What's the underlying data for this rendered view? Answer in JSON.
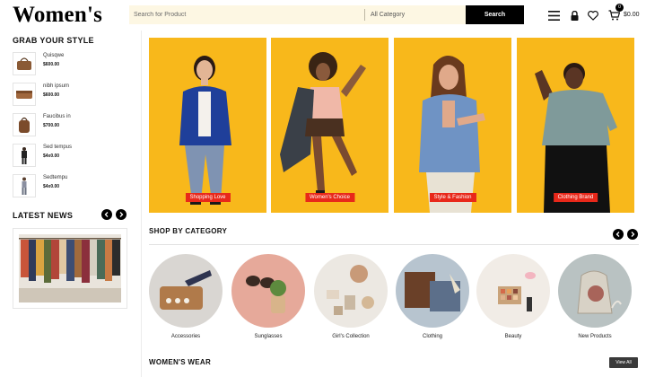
{
  "header": {
    "logo": "Women's",
    "search_placeholder": "Search for Product",
    "category_value": "All Category",
    "search_button": "Search",
    "cart_count": "0",
    "cart_total": "$0.00"
  },
  "sidebar": {
    "grab_title": "GRAB YOUR STYLE",
    "products": [
      {
        "name": "Quisqwe",
        "price": "$600.00"
      },
      {
        "name": "nibh ipsum",
        "price": "$600.00"
      },
      {
        "name": "Faucibus in",
        "price": "$700.00"
      },
      {
        "name": "Sed tempus",
        "price": "$4x0.00"
      },
      {
        "name": "Sedtempu",
        "price": "$4x0.00"
      }
    ],
    "news_title": "LATEST NEWS"
  },
  "banners": [
    {
      "label": "Shopping Love"
    },
    {
      "label": "Women's Choice"
    },
    {
      "label": "Style & Fashion"
    },
    {
      "label": "Clothing Brand"
    }
  ],
  "categories_section": {
    "title": "SHOP BY CATEGORY",
    "items": [
      {
        "label": "Accessories"
      },
      {
        "label": "Sunglasses"
      },
      {
        "label": "Girl's Collection"
      },
      {
        "label": "Clothing"
      },
      {
        "label": "Beauty"
      },
      {
        "label": "New Products"
      }
    ]
  },
  "wear_section": {
    "title": "WOMEN'S WEAR",
    "view_all": "View All"
  },
  "colors": {
    "banner_bg": "#f8b81b",
    "label_red": "#e8281a",
    "search_bg": "#fdf7e3"
  }
}
